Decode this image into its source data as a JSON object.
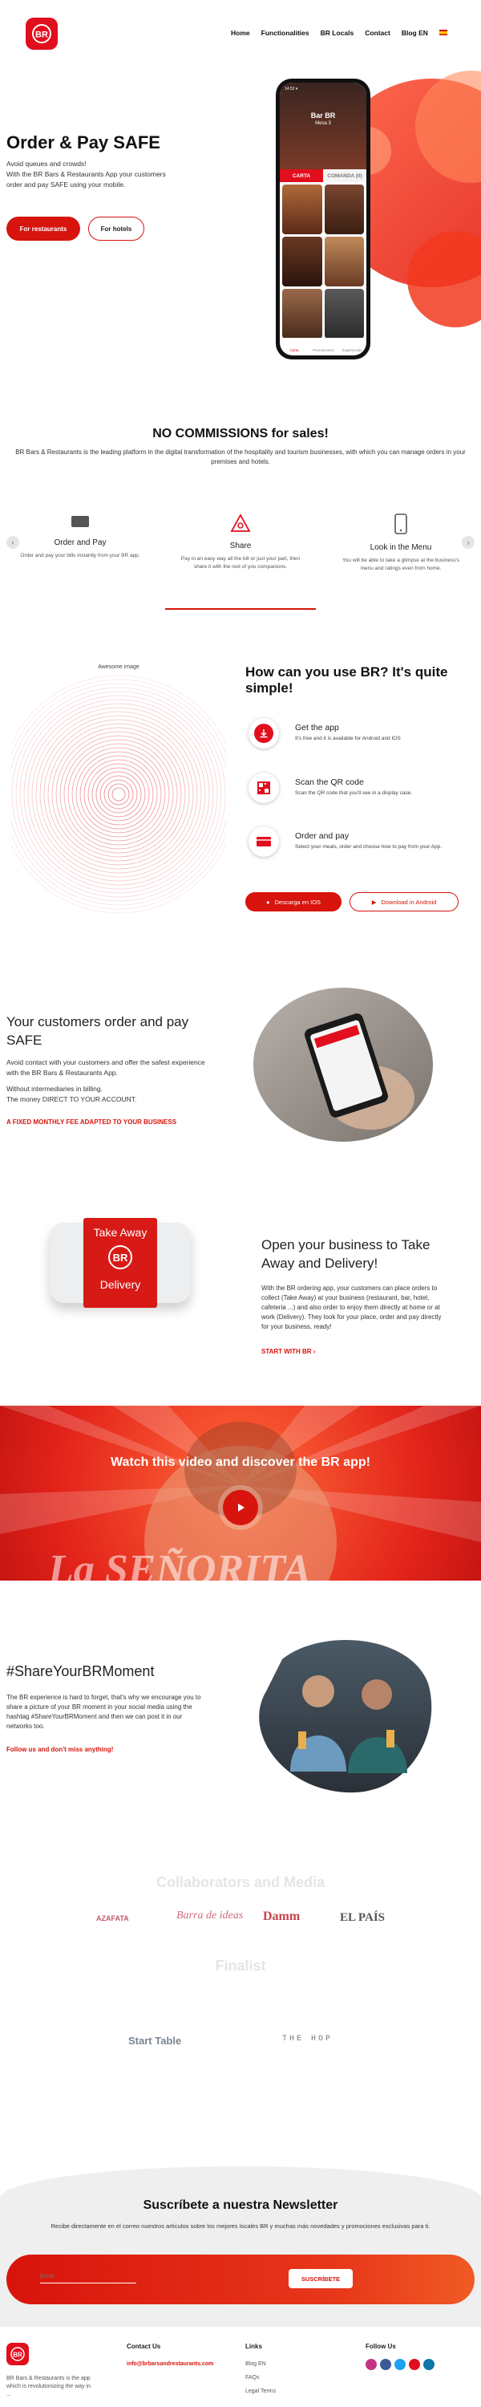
{
  "nav": {
    "items": [
      "Home",
      "Functionalities",
      "BR Locals",
      "Contact",
      "Blog EN"
    ],
    "lang_icon": "spain-flag-icon"
  },
  "hero": {
    "title": "Order & Pay SAFE",
    "subtitle_lines": [
      "Avoid queues and crowds!",
      "With the BR Bars & Restaurants App your customers",
      "order and pay SAFE using your mobile."
    ],
    "btn_restaurants": "For restaurants",
    "btn_hotels": "For hotels"
  },
  "phone": {
    "venue": "Bar BR",
    "table": "Mesa 3",
    "tabs": [
      "CARTA",
      "COMANDA (0)"
    ],
    "nav": [
      "Carta",
      "Promociones",
      "Sugerencias"
    ]
  },
  "commissions": {
    "title": "NO COMMISSIONS for sales!",
    "text": "BR Bars & Restaurants is the leading platform in the digital transformation of the hospitality and tourism businesses, with which you can manage orders in your premises and hotels."
  },
  "features": [
    {
      "title": "Order and Pay",
      "desc": "Order and pay your bills instantly from your BR app."
    },
    {
      "title": "Share",
      "desc": "Pay in an easy way all the bill or just your part, then share it with the rest of you companions."
    },
    {
      "title": "Look in the Menu",
      "desc": "You will be able to take a glimpse at the business's menu and ratings even from home."
    }
  ],
  "usage": {
    "image_alt": "Awesome image",
    "title": "How can you use BR? It's quite simple!",
    "steps": [
      {
        "title": "Get the app",
        "desc": "It's free and it is available for Android and IOS",
        "icon": "download-icon"
      },
      {
        "title": "Scan the QR code",
        "desc": "Scan the QR code that you'll see in a display case.",
        "icon": "qr-code-icon"
      },
      {
        "title": "Order and pay",
        "desc": "Select your meals, order and choose how to pay from your App.",
        "icon": "credit-card-icon"
      }
    ],
    "btn_ios": "Descarga en IOS",
    "btn_android": "Download in Android"
  },
  "customers": {
    "title_lines": [
      "Your customers order and pay",
      "SAFE"
    ],
    "text_lines": [
      "Avoid contact with your customers and offer the safest experience",
      "with the BR Bars & Restaurants App."
    ],
    "text2_lines": [
      "Without intermediaries in billing.",
      "The money DIRECT TO YOUR ACCOUNT."
    ],
    "link": "A FIXED MONTHLY FEE ADAPTED TO YOUR BUSINESS"
  },
  "takeaway": {
    "box_top": "Take Away",
    "box_bottom": "Delivery",
    "title_lines": [
      "Open your business to Take",
      "Away and Delivery!"
    ],
    "text_lines": [
      "With the BR ordering app, your customers can place orders to",
      "collect (Take Away) at your business (restaurant, bar, hotel,",
      "cafeteria ...) and also order to enjoy them directly at home or at",
      "work (Delivery). They look for your place, order and pay directly",
      "for your business, ready!"
    ],
    "link": "START WITH BR  ›"
  },
  "video": {
    "title": "Watch this video and discover the BR app!",
    "backdrop_text": "La SEÑORITA"
  },
  "share": {
    "title": "#ShareYourBRMoment",
    "text_lines": [
      "The BR experience is hard to forget, that's why we encourage you to",
      "share a picture of your BR moment in your social media using the",
      "hashtag #ShareYourBRMoment and then we can post it in our",
      "networks too."
    ],
    "link": "Follow us and don't miss anything!"
  },
  "collaborators": {
    "title": "Collaborators and Media",
    "logos": [
      "AZAFATA",
      "Barra de ideas",
      "Damm",
      "EL PAÍS"
    ]
  },
  "finalist": {
    "title": "Finalist",
    "logos": [
      "Start Table",
      "THE HOP"
    ]
  },
  "newsletter": {
    "title": "Suscríbete a nuestra Newsletter",
    "text": "Recibe directamente en el correo nuestros artículos sobre los mejores locales BR y muchas más novedades y promociones exclusivas para ti.",
    "email_placeholder": "Email",
    "button": "SUSCRÍBETE"
  },
  "footer": {
    "about_lines": [
      "BR Bars & Restaurants is the app",
      "which is revolutionizing the way in",
      "..."
    ],
    "contact_title": "Contact Us",
    "contact_email": "info@brbarsandrestaurants.com",
    "links_title": "Links",
    "links": [
      "Blog EN",
      "FAQs",
      "Legal Terms"
    ],
    "follow_title": "Follow Us"
  },
  "colors": {
    "brand_red": "#e10e1e"
  }
}
